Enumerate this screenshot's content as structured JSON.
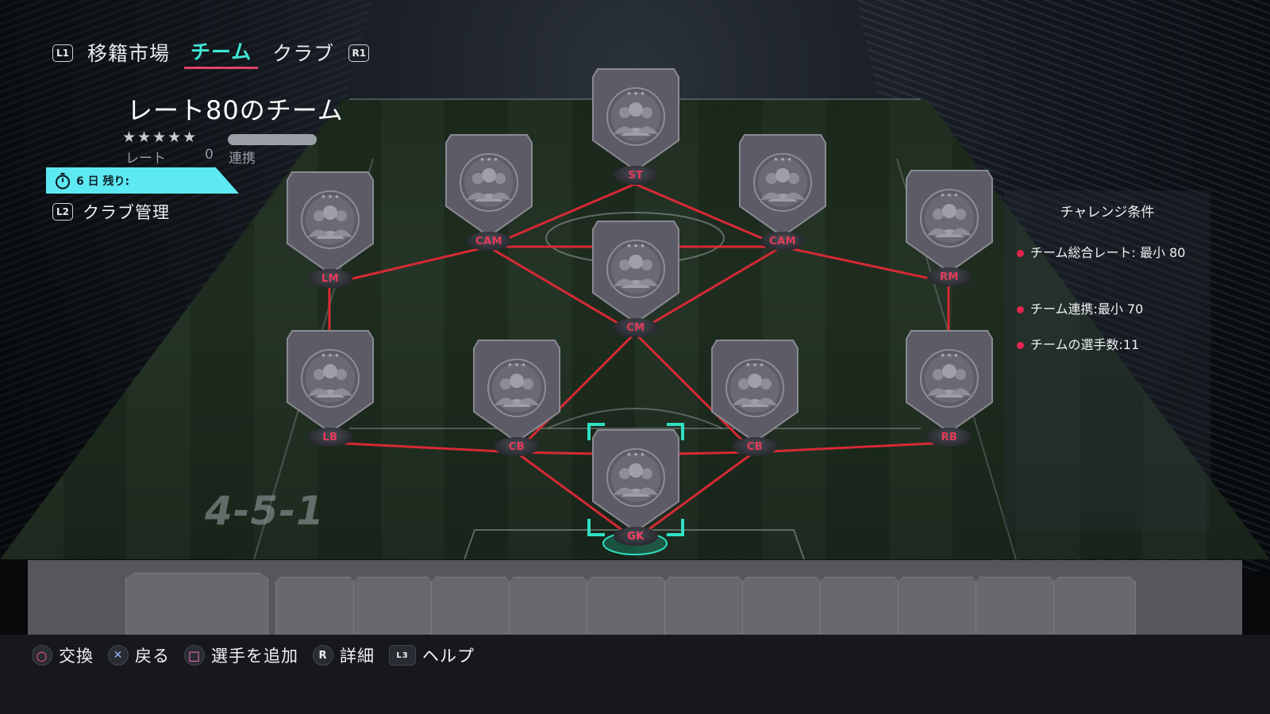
{
  "nav": {
    "left_button": "L1",
    "right_button": "R1",
    "tabs": [
      {
        "label": "移籍市場"
      },
      {
        "label": "チーム"
      },
      {
        "label": "クラブ"
      }
    ]
  },
  "team": {
    "title": "レート80のチーム",
    "stars": "★★★★★",
    "rate_label": "レート",
    "rate_value": "0",
    "chem_label": "連携",
    "timer_text": "6 日 残り:",
    "club_mgmt_button": "L2",
    "club_mgmt_label": "クラブ管理"
  },
  "formation": "4-5-1",
  "positions": [
    {
      "id": "st",
      "label": "ST"
    },
    {
      "id": "cam-left",
      "label": "CAM"
    },
    {
      "id": "cam-right",
      "label": "CAM"
    },
    {
      "id": "lm",
      "label": "LM"
    },
    {
      "id": "rm",
      "label": "RM"
    },
    {
      "id": "cm",
      "label": "CM"
    },
    {
      "id": "lb",
      "label": "LB"
    },
    {
      "id": "cb-left",
      "label": "CB"
    },
    {
      "id": "cb-right",
      "label": "CB"
    },
    {
      "id": "rb",
      "label": "RB"
    },
    {
      "id": "gk",
      "label": "GK"
    }
  ],
  "challenge": {
    "title": "チャレンジ条件",
    "requirements": [
      "チーム総合レート: 最小 80",
      "チーム連携:最小 70",
      "チームの選手数:11"
    ]
  },
  "footer": {
    "hints": [
      {
        "icon": "circle-button-icon",
        "glyph": "○",
        "label": "交換"
      },
      {
        "icon": "cross-button-icon",
        "glyph": "✕",
        "label": "戻る"
      },
      {
        "icon": "square-button-icon",
        "glyph": "□",
        "label": "選手を追加"
      },
      {
        "icon": "right-stick-icon",
        "glyph": "R",
        "label": "詳細"
      },
      {
        "icon": "left-stick-l3-icon",
        "glyph": "L3",
        "label": "ヘルプ"
      }
    ]
  },
  "colors": {
    "accent_cyan": "#3fe6d4",
    "tab_underline": "#e2426a",
    "link_red": "#e02a36",
    "position_label": "#e43b5a",
    "selection": "#2fe0c2"
  }
}
